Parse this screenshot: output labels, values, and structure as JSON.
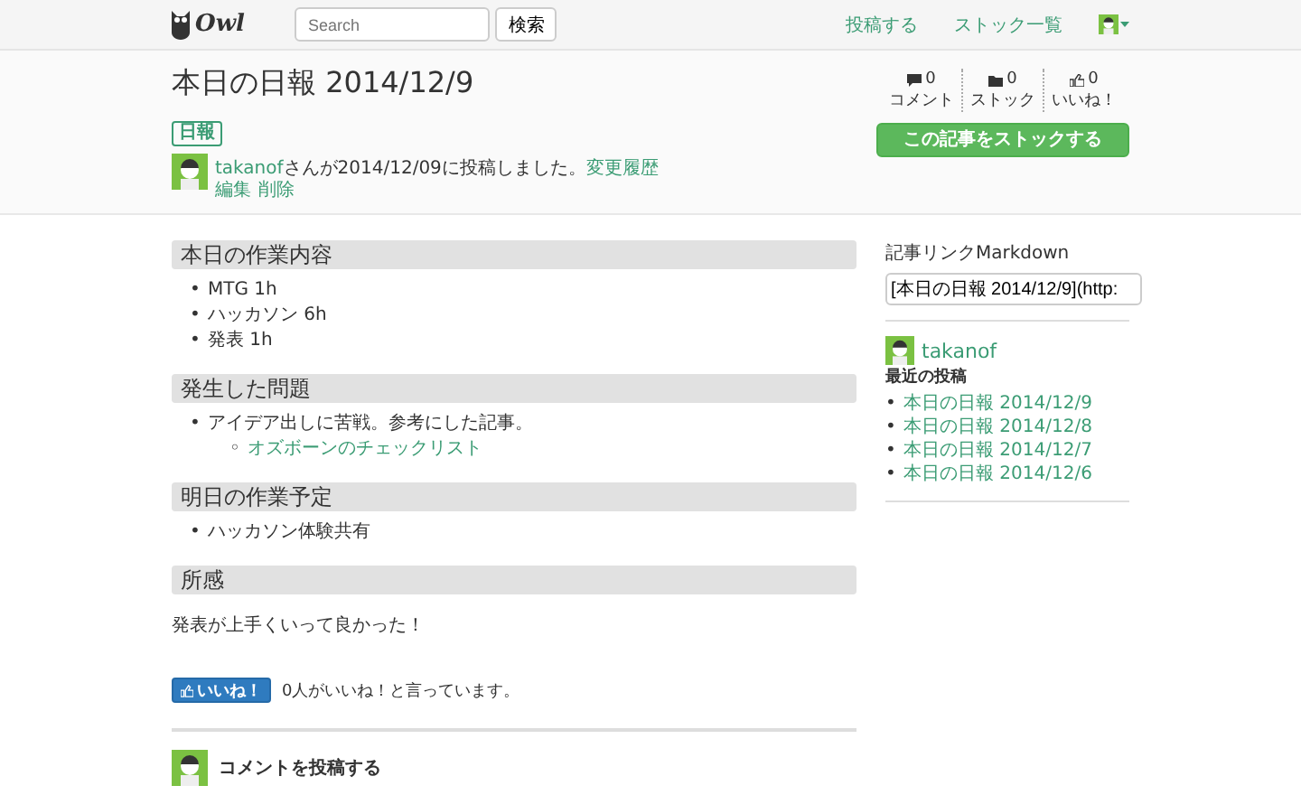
{
  "navbar": {
    "logo": "Owl",
    "search": {
      "placeholder": "Search"
    },
    "search_button": "検索",
    "links": [
      "投稿する",
      "ストック一覧"
    ]
  },
  "article": {
    "title": "本日の日報 2014/12/9",
    "tags": [
      "日報"
    ],
    "author": "takanof",
    "posted_text": "さんが2014/12/09に投稿しました。",
    "history_link": "変更履歴",
    "actions": [
      "編集",
      "削除"
    ],
    "stats": [
      {
        "kind": "comment",
        "count": "0",
        "label": "コメント"
      },
      {
        "kind": "stock",
        "count": "0",
        "label": "ストック"
      },
      {
        "kind": "like",
        "count": "0",
        "label": "いいね！"
      }
    ],
    "stock_button": "この記事をストックする"
  },
  "body": [
    {
      "kind": "heading",
      "text": "本日の作業内容"
    },
    {
      "kind": "list",
      "items": [
        {
          "marker": "•",
          "kind": "text",
          "text": "MTG 1h"
        },
        {
          "marker": "•",
          "kind": "text",
          "text": "ハッカソン 6h"
        },
        {
          "marker": "•",
          "kind": "text",
          "text": "発表 1h"
        }
      ]
    },
    {
      "kind": "heading",
      "text": "発生した問題"
    },
    {
      "kind": "list",
      "items": [
        {
          "marker": "•",
          "kind": "text",
          "text": "アイデア出しに苦戦。参考にした記事。",
          "children": [
            {
              "marker": "◦",
              "kind": "link",
              "text": "オズボーンのチェックリスト"
            }
          ]
        }
      ]
    },
    {
      "kind": "heading",
      "text": "明日の作業予定"
    },
    {
      "kind": "list",
      "items": [
        {
          "marker": "•",
          "kind": "text",
          "text": "ハッカソン体験共有"
        }
      ]
    },
    {
      "kind": "heading",
      "text": "所感"
    },
    {
      "kind": "paragraph",
      "text": "発表が上手くいって良かった！"
    }
  ],
  "like": {
    "button": "いいね！",
    "text": "0人がいいね！と言っています。"
  },
  "comment": {
    "title": "コメントを投稿する"
  },
  "sidebar": {
    "markdown_label": "記事リンクMarkdown",
    "markdown_value": "[本日の日報 2014/12/9](http:",
    "user": "takanof",
    "recent_title": "最近の投稿",
    "recent": [
      {
        "marker": "•",
        "text": "本日の日報 2014/12/9"
      },
      {
        "marker": "•",
        "text": "本日の日報 2014/12/8"
      },
      {
        "marker": "•",
        "text": "本日の日報 2014/12/7"
      },
      {
        "marker": "•",
        "text": "本日の日報 2014/12/6"
      }
    ]
  }
}
